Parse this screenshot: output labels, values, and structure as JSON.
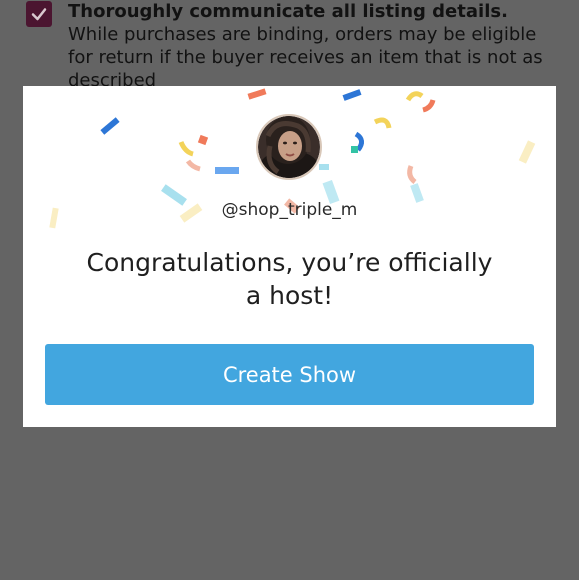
{
  "background": {
    "checklist_item": {
      "checked": true,
      "bold_text": "Thoroughly communicate all listing details.",
      "body_text": " While purchases are binding, orders may be eligible for return if the buyer receives an item that is not as described"
    }
  },
  "modal": {
    "avatar_icon": "user-avatar",
    "handle": "@shop_triple_m",
    "headline": "Congratulations, you’re officially a host!",
    "cta_label": "Create Show"
  },
  "colors": {
    "overlay": "#646464",
    "cta": "#42a6df",
    "checkbox": "#4b1530"
  }
}
